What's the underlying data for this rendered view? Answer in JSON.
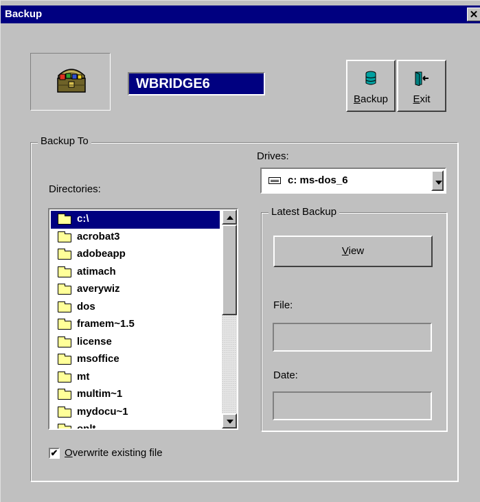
{
  "window": {
    "title": "Backup",
    "close_glyph": "✕"
  },
  "header": {
    "computer_name": "WBRIDGE6",
    "icon": "treasure-chest-icon"
  },
  "toolbar": {
    "backup_label_u": "B",
    "backup_label_rest": "ackup",
    "backup_icon": "database-icon",
    "exit_label_u": "E",
    "exit_label_rest": "xit",
    "exit_icon": "exit-door-icon"
  },
  "backup_to": {
    "group_label": "Backup To",
    "drives_label": "Drives:",
    "drive_value": "c: ms-dos_6",
    "directories_label": "Directories:",
    "directories": [
      {
        "name": "c:\\",
        "selected": true,
        "icon": "open-folder-icon"
      },
      {
        "name": "acrobat3"
      },
      {
        "name": "adobeapp"
      },
      {
        "name": "atimach"
      },
      {
        "name": "averywiz"
      },
      {
        "name": "dos"
      },
      {
        "name": "framem~1.5"
      },
      {
        "name": "license"
      },
      {
        "name": "msoffice"
      },
      {
        "name": "mt"
      },
      {
        "name": "multim~1"
      },
      {
        "name": "mydocu~1"
      },
      {
        "name": "onlt"
      }
    ]
  },
  "latest_backup": {
    "group_label": "Latest Backup",
    "view_label_u": "V",
    "view_label_rest": "iew",
    "file_label": "File:",
    "file_value": "",
    "date_label": "Date:",
    "date_value": ""
  },
  "options": {
    "overwrite_u": "O",
    "overwrite_rest": "verwrite existing file",
    "overwrite_checked": "✔"
  }
}
